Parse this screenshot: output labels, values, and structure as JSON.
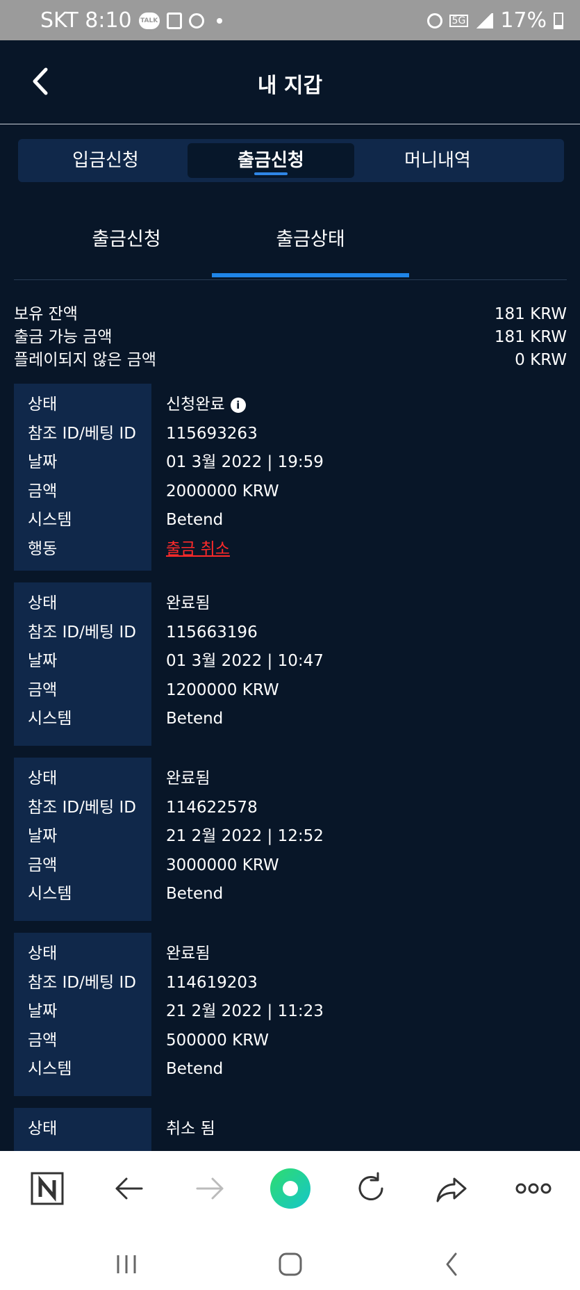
{
  "status_bar": {
    "carrier_time": "SKT 8:10",
    "battery": "17%",
    "talk": "TALK"
  },
  "header": {
    "title": "내 지갑"
  },
  "segment_tabs": [
    {
      "label": "입금신청"
    },
    {
      "label": "출금신청"
    },
    {
      "label": "머니내역"
    }
  ],
  "sub_tabs": [
    {
      "label": "출금신청"
    },
    {
      "label": "출금상태"
    }
  ],
  "summary": [
    {
      "label": "보유 잔액",
      "value": "181 KRW"
    },
    {
      "label": "출금 가능 금액",
      "value": "181 KRW"
    },
    {
      "label": "플레이되지 않은 금액",
      "value": "0 KRW"
    }
  ],
  "labels": {
    "status": "상태",
    "ref_id": "참조 ID/베팅 ID",
    "date": "날짜",
    "amount": "금액",
    "system": "시스템",
    "action": "행동"
  },
  "records": [
    {
      "status": "신청완료",
      "ref_id": "115693263",
      "date": "01 3월 2022 | 19:59",
      "amount": "2000000 KRW",
      "system": "Betend",
      "action": "출금 취소"
    },
    {
      "status": "완료됨",
      "ref_id": "115663196",
      "date": "01 3월 2022 | 10:47",
      "amount": "1200000 KRW",
      "system": "Betend"
    },
    {
      "status": "완료됨",
      "ref_id": "114622578",
      "date": "21 2월 2022 | 12:52",
      "amount": "3000000 KRW",
      "system": "Betend"
    },
    {
      "status": "완료됨",
      "ref_id": "114619203",
      "date": "21 2월 2022 | 11:23",
      "amount": "500000 KRW",
      "system": "Betend"
    },
    {
      "status": "취소 됨"
    }
  ],
  "colors": {
    "background": "#081628",
    "panel": "#10284a",
    "accent": "#1f85e8",
    "danger": "#ff2a2a"
  },
  "toolbar_icons": [
    "naver-icon",
    "back-arrow-icon",
    "forward-arrow-icon",
    "home-green-icon",
    "refresh-icon",
    "share-icon",
    "more-icon"
  ]
}
